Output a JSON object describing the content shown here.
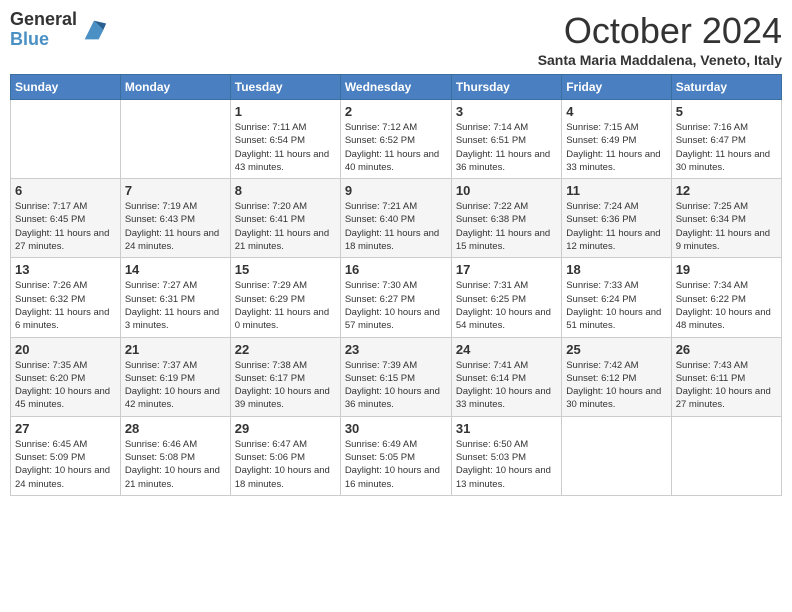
{
  "logo": {
    "general": "General",
    "blue": "Blue"
  },
  "header": {
    "month": "October 2024",
    "subtitle": "Santa Maria Maddalena, Veneto, Italy"
  },
  "weekdays": [
    "Sunday",
    "Monday",
    "Tuesday",
    "Wednesday",
    "Thursday",
    "Friday",
    "Saturday"
  ],
  "weeks": [
    [
      {
        "day": "",
        "sunrise": "",
        "sunset": "",
        "daylight": ""
      },
      {
        "day": "",
        "sunrise": "",
        "sunset": "",
        "daylight": ""
      },
      {
        "day": "1",
        "sunrise": "Sunrise: 7:11 AM",
        "sunset": "Sunset: 6:54 PM",
        "daylight": "Daylight: 11 hours and 43 minutes."
      },
      {
        "day": "2",
        "sunrise": "Sunrise: 7:12 AM",
        "sunset": "Sunset: 6:52 PM",
        "daylight": "Daylight: 11 hours and 40 minutes."
      },
      {
        "day": "3",
        "sunrise": "Sunrise: 7:14 AM",
        "sunset": "Sunset: 6:51 PM",
        "daylight": "Daylight: 11 hours and 36 minutes."
      },
      {
        "day": "4",
        "sunrise": "Sunrise: 7:15 AM",
        "sunset": "Sunset: 6:49 PM",
        "daylight": "Daylight: 11 hours and 33 minutes."
      },
      {
        "day": "5",
        "sunrise": "Sunrise: 7:16 AM",
        "sunset": "Sunset: 6:47 PM",
        "daylight": "Daylight: 11 hours and 30 minutes."
      }
    ],
    [
      {
        "day": "6",
        "sunrise": "Sunrise: 7:17 AM",
        "sunset": "Sunset: 6:45 PM",
        "daylight": "Daylight: 11 hours and 27 minutes."
      },
      {
        "day": "7",
        "sunrise": "Sunrise: 7:19 AM",
        "sunset": "Sunset: 6:43 PM",
        "daylight": "Daylight: 11 hours and 24 minutes."
      },
      {
        "day": "8",
        "sunrise": "Sunrise: 7:20 AM",
        "sunset": "Sunset: 6:41 PM",
        "daylight": "Daylight: 11 hours and 21 minutes."
      },
      {
        "day": "9",
        "sunrise": "Sunrise: 7:21 AM",
        "sunset": "Sunset: 6:40 PM",
        "daylight": "Daylight: 11 hours and 18 minutes."
      },
      {
        "day": "10",
        "sunrise": "Sunrise: 7:22 AM",
        "sunset": "Sunset: 6:38 PM",
        "daylight": "Daylight: 11 hours and 15 minutes."
      },
      {
        "day": "11",
        "sunrise": "Sunrise: 7:24 AM",
        "sunset": "Sunset: 6:36 PM",
        "daylight": "Daylight: 11 hours and 12 minutes."
      },
      {
        "day": "12",
        "sunrise": "Sunrise: 7:25 AM",
        "sunset": "Sunset: 6:34 PM",
        "daylight": "Daylight: 11 hours and 9 minutes."
      }
    ],
    [
      {
        "day": "13",
        "sunrise": "Sunrise: 7:26 AM",
        "sunset": "Sunset: 6:32 PM",
        "daylight": "Daylight: 11 hours and 6 minutes."
      },
      {
        "day": "14",
        "sunrise": "Sunrise: 7:27 AM",
        "sunset": "Sunset: 6:31 PM",
        "daylight": "Daylight: 11 hours and 3 minutes."
      },
      {
        "day": "15",
        "sunrise": "Sunrise: 7:29 AM",
        "sunset": "Sunset: 6:29 PM",
        "daylight": "Daylight: 11 hours and 0 minutes."
      },
      {
        "day": "16",
        "sunrise": "Sunrise: 7:30 AM",
        "sunset": "Sunset: 6:27 PM",
        "daylight": "Daylight: 10 hours and 57 minutes."
      },
      {
        "day": "17",
        "sunrise": "Sunrise: 7:31 AM",
        "sunset": "Sunset: 6:25 PM",
        "daylight": "Daylight: 10 hours and 54 minutes."
      },
      {
        "day": "18",
        "sunrise": "Sunrise: 7:33 AM",
        "sunset": "Sunset: 6:24 PM",
        "daylight": "Daylight: 10 hours and 51 minutes."
      },
      {
        "day": "19",
        "sunrise": "Sunrise: 7:34 AM",
        "sunset": "Sunset: 6:22 PM",
        "daylight": "Daylight: 10 hours and 48 minutes."
      }
    ],
    [
      {
        "day": "20",
        "sunrise": "Sunrise: 7:35 AM",
        "sunset": "Sunset: 6:20 PM",
        "daylight": "Daylight: 10 hours and 45 minutes."
      },
      {
        "day": "21",
        "sunrise": "Sunrise: 7:37 AM",
        "sunset": "Sunset: 6:19 PM",
        "daylight": "Daylight: 10 hours and 42 minutes."
      },
      {
        "day": "22",
        "sunrise": "Sunrise: 7:38 AM",
        "sunset": "Sunset: 6:17 PM",
        "daylight": "Daylight: 10 hours and 39 minutes."
      },
      {
        "day": "23",
        "sunrise": "Sunrise: 7:39 AM",
        "sunset": "Sunset: 6:15 PM",
        "daylight": "Daylight: 10 hours and 36 minutes."
      },
      {
        "day": "24",
        "sunrise": "Sunrise: 7:41 AM",
        "sunset": "Sunset: 6:14 PM",
        "daylight": "Daylight: 10 hours and 33 minutes."
      },
      {
        "day": "25",
        "sunrise": "Sunrise: 7:42 AM",
        "sunset": "Sunset: 6:12 PM",
        "daylight": "Daylight: 10 hours and 30 minutes."
      },
      {
        "day": "26",
        "sunrise": "Sunrise: 7:43 AM",
        "sunset": "Sunset: 6:11 PM",
        "daylight": "Daylight: 10 hours and 27 minutes."
      }
    ],
    [
      {
        "day": "27",
        "sunrise": "Sunrise: 6:45 AM",
        "sunset": "Sunset: 5:09 PM",
        "daylight": "Daylight: 10 hours and 24 minutes."
      },
      {
        "day": "28",
        "sunrise": "Sunrise: 6:46 AM",
        "sunset": "Sunset: 5:08 PM",
        "daylight": "Daylight: 10 hours and 21 minutes."
      },
      {
        "day": "29",
        "sunrise": "Sunrise: 6:47 AM",
        "sunset": "Sunset: 5:06 PM",
        "daylight": "Daylight: 10 hours and 18 minutes."
      },
      {
        "day": "30",
        "sunrise": "Sunrise: 6:49 AM",
        "sunset": "Sunset: 5:05 PM",
        "daylight": "Daylight: 10 hours and 16 minutes."
      },
      {
        "day": "31",
        "sunrise": "Sunrise: 6:50 AM",
        "sunset": "Sunset: 5:03 PM",
        "daylight": "Daylight: 10 hours and 13 minutes."
      },
      {
        "day": "",
        "sunrise": "",
        "sunset": "",
        "daylight": ""
      },
      {
        "day": "",
        "sunrise": "",
        "sunset": "",
        "daylight": ""
      }
    ]
  ]
}
